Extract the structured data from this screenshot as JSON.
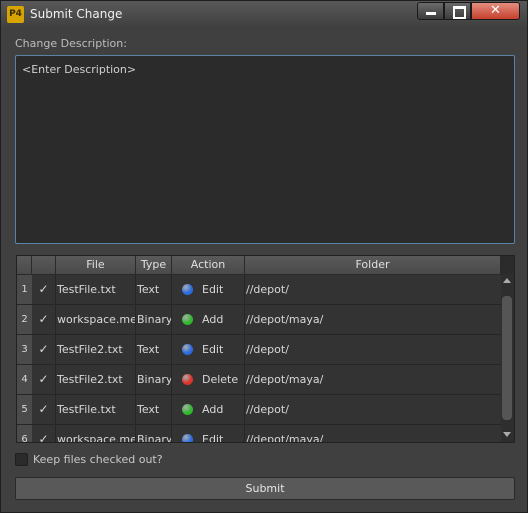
{
  "window": {
    "title": "Submit Change",
    "app_icon_text": "P4",
    "close_glyph": "✕"
  },
  "description": {
    "label": "Change Description:",
    "placeholder": "<Enter Description>"
  },
  "table": {
    "columns": [
      "",
      "",
      "File",
      "Type",
      "Action",
      "Folder"
    ],
    "rows": [
      {
        "num": "1",
        "checked": "✓",
        "file": "TestFile.txt",
        "type": "Text",
        "action": "Edit",
        "action_color": "#2a6be0",
        "folder": "//depot/"
      },
      {
        "num": "2",
        "checked": "✓",
        "file": "workspace.mel",
        "type": "Binary",
        "action": "Add",
        "action_color": "#2fb82c",
        "folder": "//depot/maya/"
      },
      {
        "num": "3",
        "checked": "✓",
        "file": "TestFile2.txt",
        "type": "Text",
        "action": "Edit",
        "action_color": "#2a6be0",
        "folder": "//depot/"
      },
      {
        "num": "4",
        "checked": "✓",
        "file": "TestFile2.txt",
        "type": "Binary",
        "action": "Delete",
        "action_color": "#d9332a",
        "folder": "//depot/maya/"
      },
      {
        "num": "5",
        "checked": "✓",
        "file": "TestFile.txt",
        "type": "Text",
        "action": "Add",
        "action_color": "#2fb82c",
        "folder": "//depot/"
      },
      {
        "num": "6",
        "checked": "✓",
        "file": "workspace.mel",
        "type": "Binary",
        "action": "Edit",
        "action_color": "#2a6be0",
        "folder": "//depot/maya/"
      }
    ]
  },
  "keep_checked_out": {
    "label": "Keep files checked out?",
    "checked": false
  },
  "submit_label": "Submit",
  "colors": {
    "accent_border": "#5d82a8",
    "close_button": "#c6402d",
    "edit": "#2a6be0",
    "add": "#2fb82c",
    "delete": "#d9332a"
  }
}
